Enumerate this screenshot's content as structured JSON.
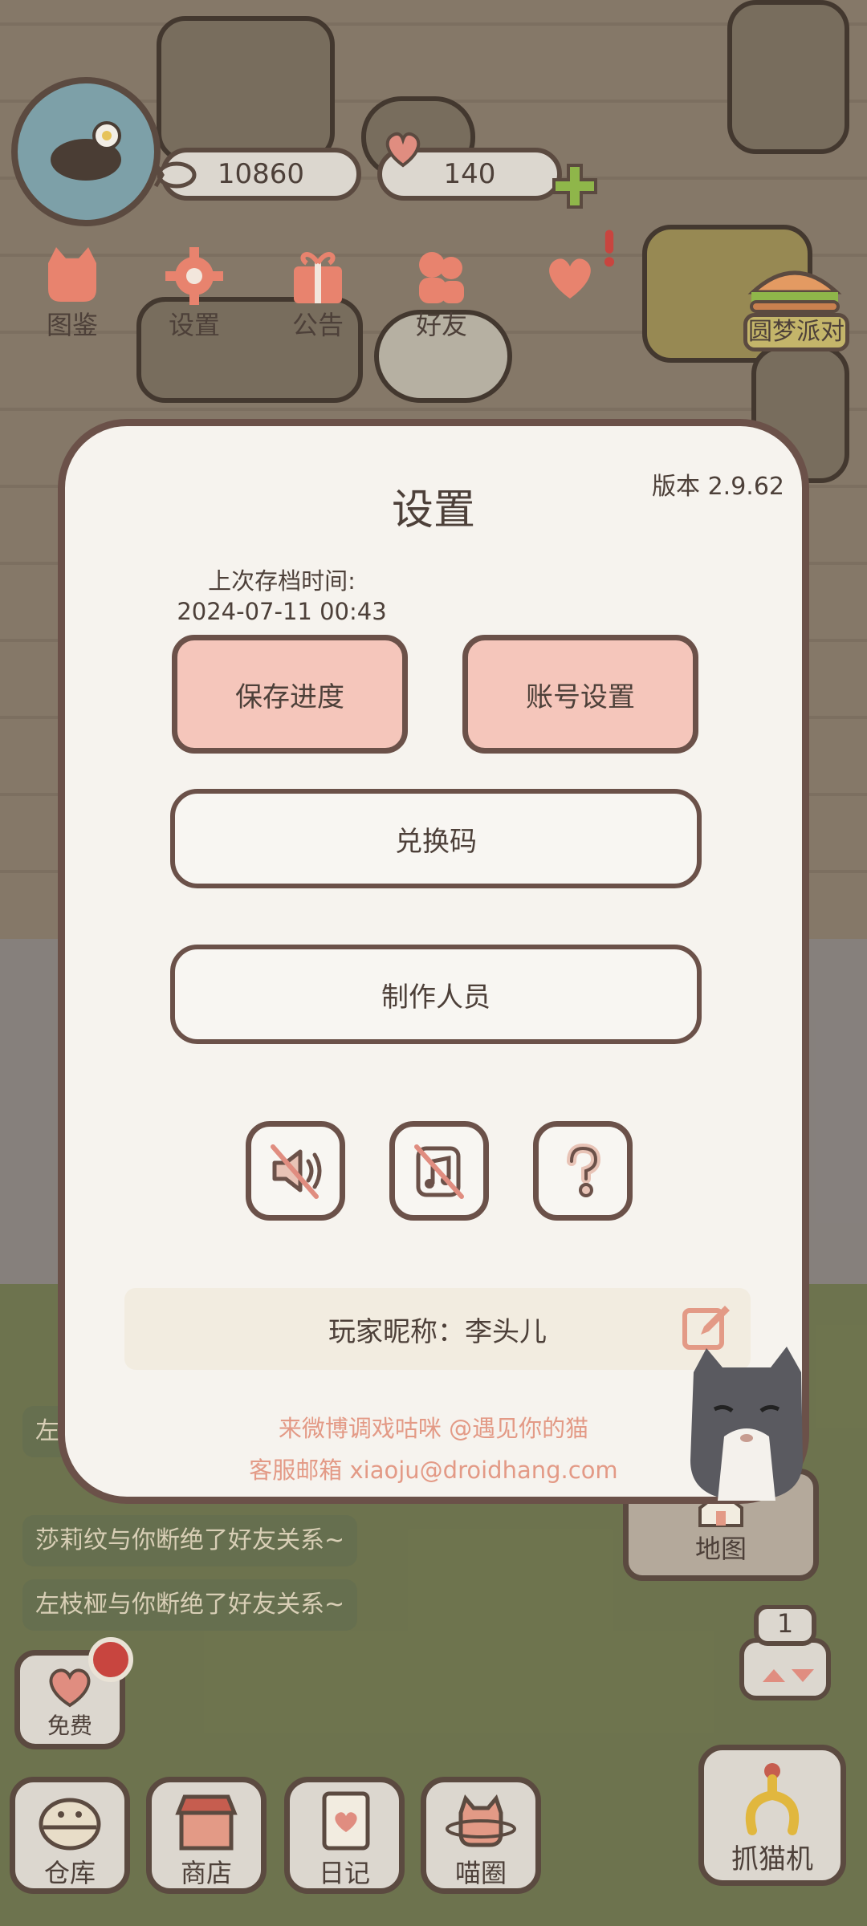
{
  "hud": {
    "fish_count": "10860",
    "heart_count": "140",
    "buttons": [
      {
        "label": "图鉴",
        "icon": "cat-face-icon"
      },
      {
        "label": "设置",
        "icon": "gear-icon"
      },
      {
        "label": "公告",
        "icon": "gift-icon"
      },
      {
        "label": "好友",
        "icon": "friends-icon"
      }
    ],
    "event_label": "圆梦派对"
  },
  "chat_messages": [
    "左枝",
    "莎莉纹与你断绝了好友关系~",
    "左枝桠与你断绝了好友关系~"
  ],
  "free_label": "免费",
  "bottom_nav": [
    {
      "label": "仓库",
      "icon": "warehouse-icon"
    },
    {
      "label": "商店",
      "icon": "shop-icon"
    },
    {
      "label": "日记",
      "icon": "diary-icon"
    },
    {
      "label": "喵圈",
      "icon": "planet-cat-icon"
    }
  ],
  "map_label": "地图",
  "ticket_count": "1",
  "claw_machine_label": "抓猫机",
  "dialog": {
    "title": "设置",
    "version": "版本 2.9.62",
    "last_save_label": "上次存档时间:",
    "last_save_time": "2024-07-11 00:43",
    "save_button": "保存进度",
    "account_button": "账号设置",
    "redeem_button": "兑换码",
    "credits_button": "制作人员",
    "icon_buttons": [
      "sound-muted-icon",
      "music-muted-icon",
      "help-icon"
    ],
    "nickname_label": "玩家昵称：",
    "nickname_value": "李头儿",
    "footer_weibo": "来微博调戏咕咪 @遇见你的猫",
    "footer_email": "客服邮箱 xiaoju@droidhang.com"
  },
  "colors": {
    "accent_pink": "#f5c6bb",
    "border_brown": "#6b5149",
    "footer_text": "#e39a86",
    "dialog_bg": "#f6f3ee"
  }
}
